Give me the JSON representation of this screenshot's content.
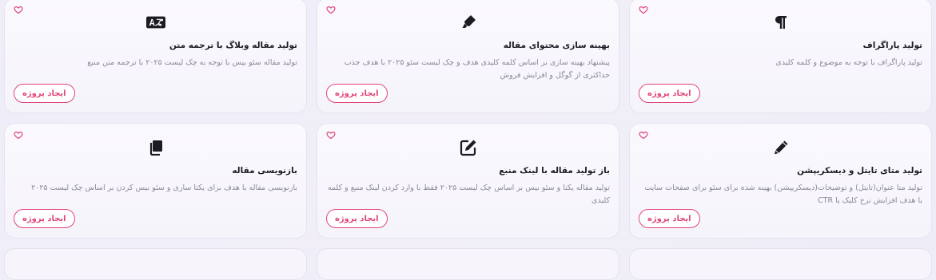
{
  "accent_color": "#e0457b",
  "cards": [
    {
      "icon": "paragraph-icon",
      "title": "تولید پاراگراف",
      "description": "تولید پاراگراف با توجه به موضوع و کلمه کلیدی",
      "button": "ایجاد پروژه"
    },
    {
      "icon": "highlighter-icon",
      "title": "بهینه سازی محتوای مقاله",
      "description": "پیشنهاد بهینه سازی بر اساس کلمه کلیدی هدف و چک لیست سئو ۲۰۲۵ با هدف جذب حداکثری از گوگل و افزایش فروش",
      "button": "ایجاد پروژه"
    },
    {
      "icon": "translate-icon",
      "title": "تولید مقاله وبلاگ با ترجمه متن",
      "description": "تولید مقاله سئو بیس با توجه به چک لیست ۲۰۲۵ با ترجمه متن منبع",
      "button": "ایجاد پروژه"
    },
    {
      "icon": "pencil-icon",
      "title": "تولید متای تایتل و دیسکریپشن",
      "description": "تولید متا عنوان(تایتل) و توضیحات(دیسکریپشن) بهینه شده برای سئو برای صفحات سایت با هدف افزایش نرخ کلیک یا CTR",
      "button": "ایجاد پروژه"
    },
    {
      "icon": "edit-icon",
      "title": "باز تولید مقاله با لینک منبع",
      "description": "تولید مقاله یکتا و سئو بیس بر اساس چک لیست ۲۰۲۵ فقط با وارد کردن لینک منبع و کلمه کلیدی",
      "button": "ایجاد پروژه"
    },
    {
      "icon": "copy-icon",
      "title": "بازنویسی مقاله",
      "description": "بازنویسی مقاله با هدف برای یکتا سازی و سئو بیس کردن بر اساس چک لیست ۲۰۲۵",
      "button": "ایجاد پروژه"
    }
  ]
}
